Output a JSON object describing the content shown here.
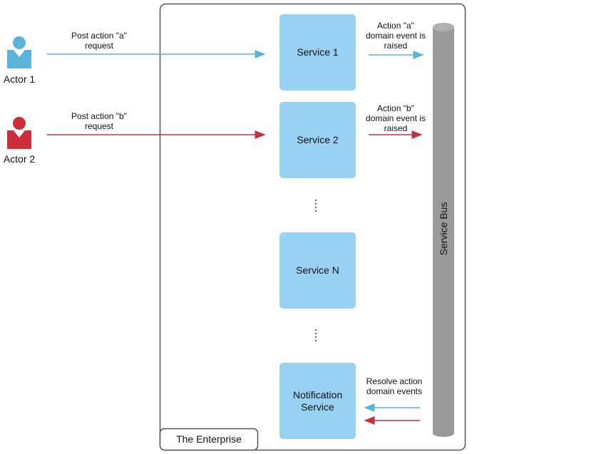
{
  "actors": [
    {
      "label": "Actor 1",
      "color": "#5ab4dc"
    },
    {
      "label": "Actor 2",
      "color": "#cc2e3a"
    }
  ],
  "requests": [
    "Post action \"a\"\nrequest",
    "Post action \"b\"\nrequest"
  ],
  "enterprise": {
    "label": "The Enterprise"
  },
  "services": [
    "Service 1",
    "Service 2",
    "Service N",
    "Notification\nService"
  ],
  "events": [
    "Action \"a\"\ndomain event is\nraised",
    "Action \"b\"\ndomain event is\nraised"
  ],
  "resolve": "Resolve action\ndomain events",
  "bus": {
    "label": "Service Bus",
    "color": "#9a9a9a"
  },
  "colors": {
    "service": "#99d1f2",
    "blue": "#5ab4dc",
    "red": "#cc2e3a"
  }
}
